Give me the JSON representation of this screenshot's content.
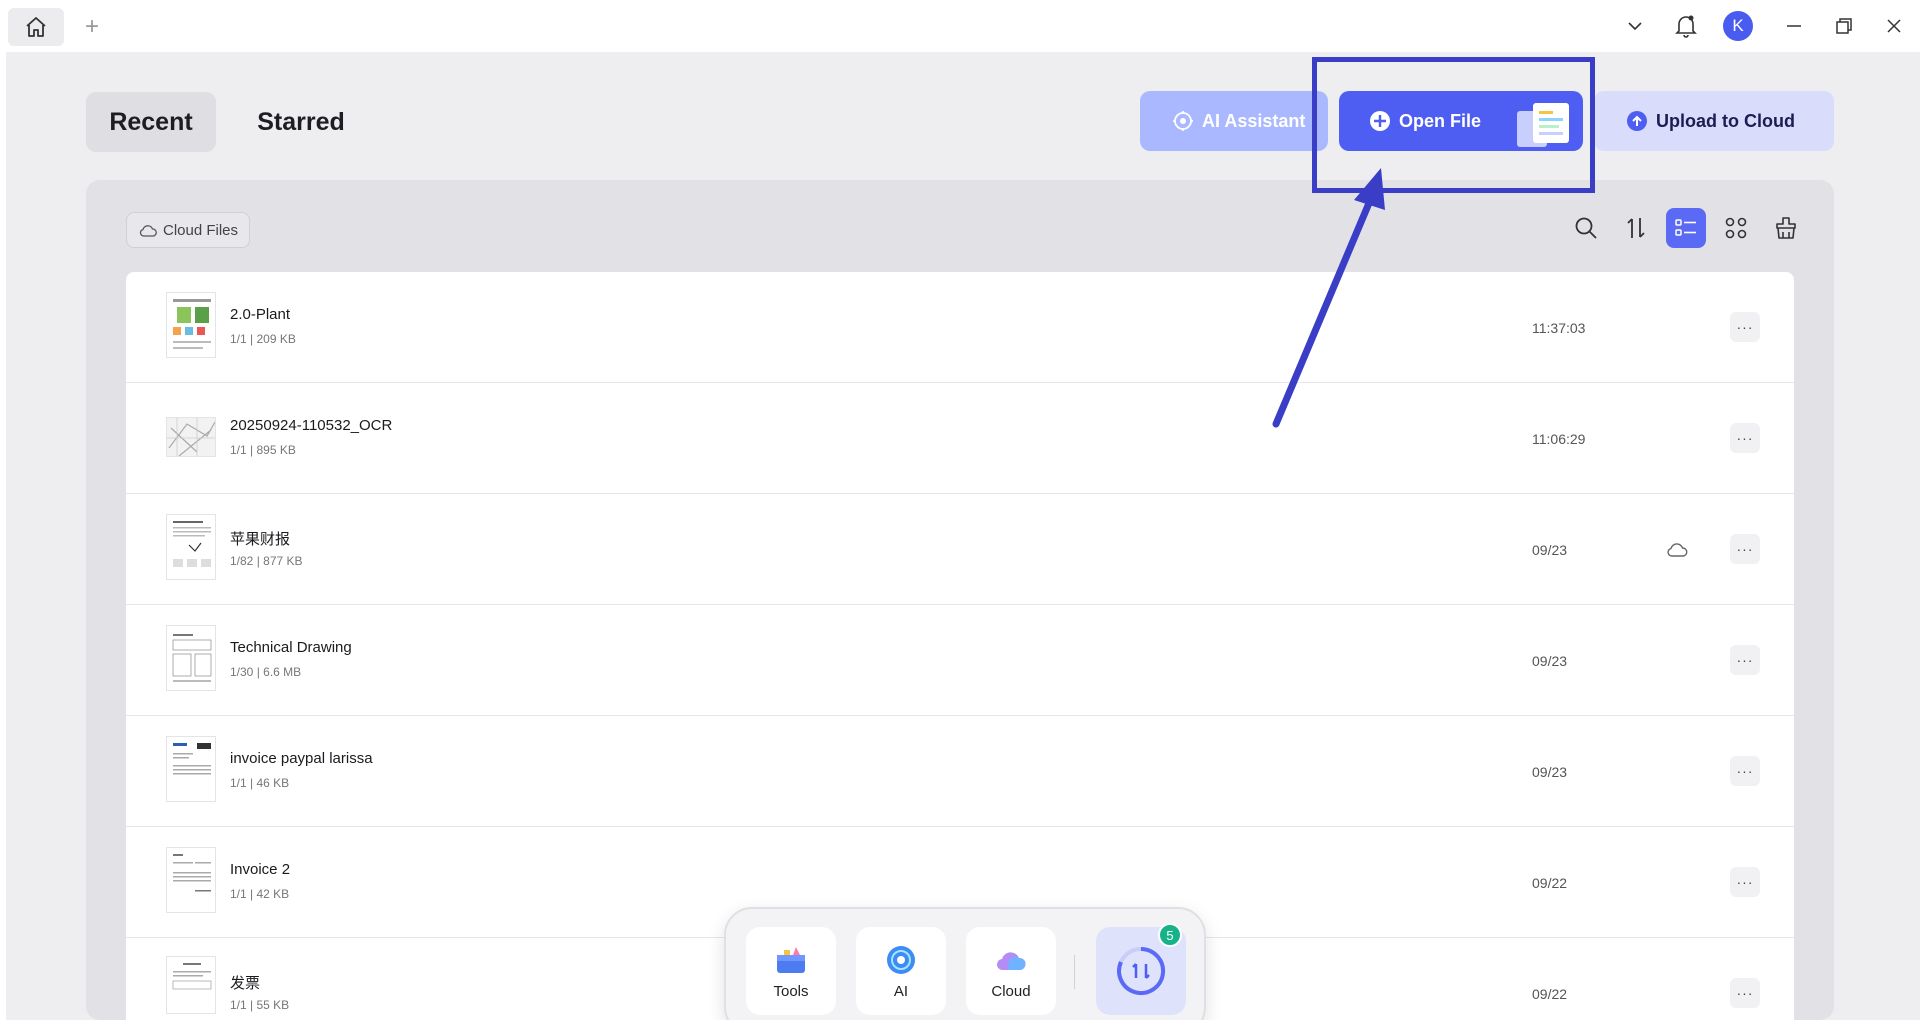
{
  "window": {
    "add_tab_glyph": "+",
    "avatar_letter": "K"
  },
  "tabs": [
    {
      "label": "Recent",
      "active": true
    },
    {
      "label": "Starred",
      "active": false
    }
  ],
  "actions": {
    "ai_assistant": "AI Assistant",
    "open_file": "Open File",
    "upload_to_cloud": "Upload to Cloud"
  },
  "toolbar": {
    "cloud_files": "Cloud Files",
    "icons": [
      "search-icon",
      "sort-icon",
      "list-view-icon",
      "grid-view-icon",
      "clear-icon"
    ],
    "active_view": "list"
  },
  "files": [
    {
      "name": "2.0-Plant",
      "meta": "1/1 | 209 KB",
      "date": "11:37:03",
      "cloud": false
    },
    {
      "name": "20250924-110532_OCR",
      "meta": "1/1 | 895 KB",
      "date": "11:06:29",
      "cloud": false
    },
    {
      "name": "苹果财报",
      "meta": "1/82 | 877 KB",
      "date": "09/23",
      "cloud": true
    },
    {
      "name": "Technical Drawing",
      "meta": "1/30 | 6.6 MB",
      "date": "09/23",
      "cloud": false
    },
    {
      "name": "invoice paypal larissa",
      "meta": "1/1 | 46 KB",
      "date": "09/23",
      "cloud": false
    },
    {
      "name": "Invoice 2",
      "meta": "1/1 | 42 KB",
      "date": "09/22",
      "cloud": false
    },
    {
      "name": "发票",
      "meta": "1/1 | 55 KB",
      "date": "09/22",
      "cloud": false
    }
  ],
  "more_glyph": "···",
  "dock": {
    "tools": "Tools",
    "ai": "AI",
    "cloud": "Cloud",
    "convert_badge": "5"
  },
  "colors": {
    "accent": "#4f5ef2",
    "highlight": "#3a3ec6",
    "badge": "#16b38a"
  }
}
